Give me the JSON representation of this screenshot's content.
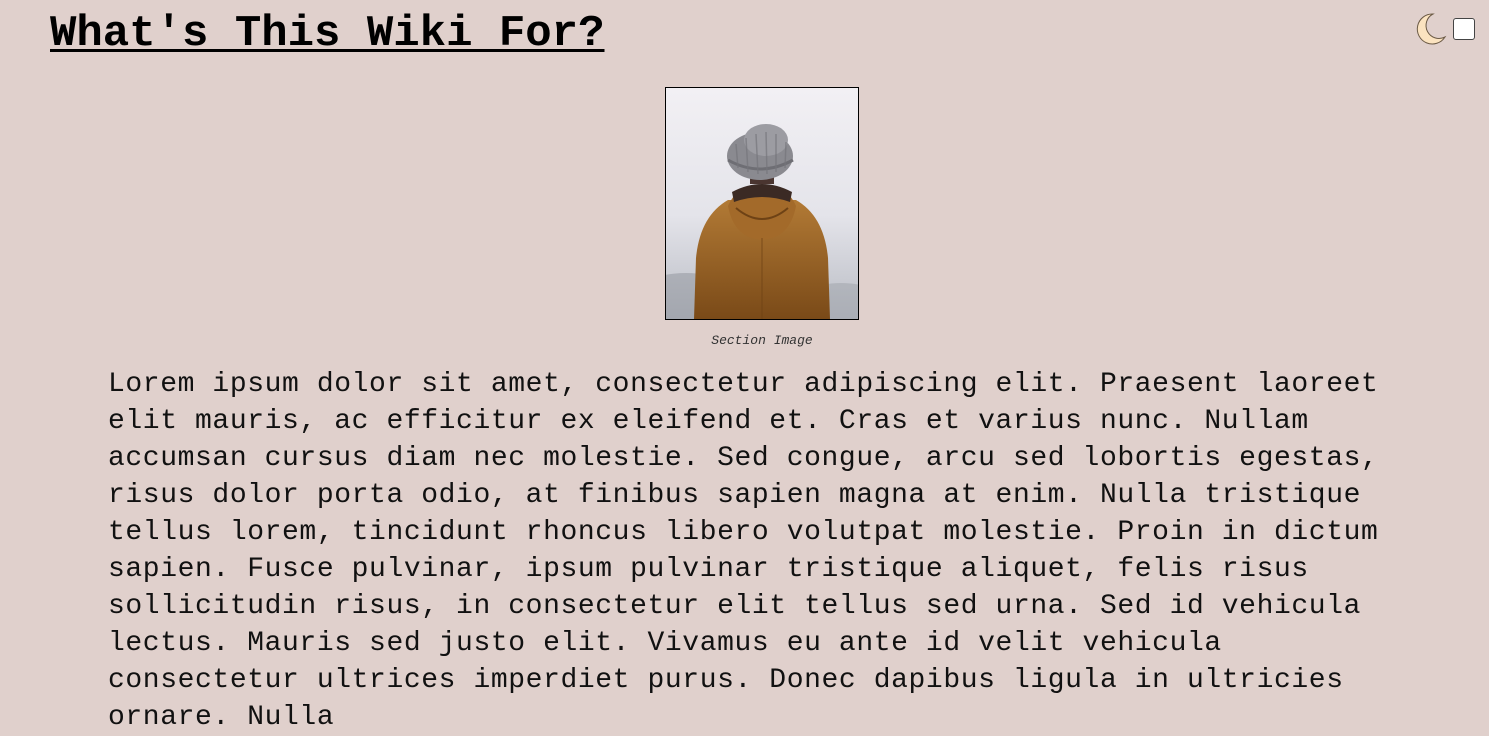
{
  "page": {
    "title": "What's This Wiki For?"
  },
  "controls": {
    "theme_icon": "moon-icon",
    "theme_toggle_checked": false
  },
  "section": {
    "image_caption": "Section Image",
    "image_subject": "person in knit beanie and orange hooded jacket seen from behind",
    "paragraph": "Lorem ipsum dolor sit amet, consectetur adipiscing elit. Praesent laoreet elit mauris, ac efficitur ex eleifend et. Cras et varius nunc. Nullam accumsan cursus diam nec molestie. Sed congue, arcu sed lobortis egestas, risus dolor porta odio, at finibus sapien magna at enim. Nulla tristique tellus lorem, tincidunt rhoncus libero volutpat molestie. Proin in dictum sapien. Fusce pulvinar, ipsum pulvinar tristique aliquet, felis risus sollicitudin risus, in consectetur elit tellus sed urna. Sed id vehicula lectus. Mauris sed justo elit. Vivamus eu ante id velit vehicula consectetur ultrices imperdiet purus. Donec dapibus ligula in ultricies ornare. Nulla"
  },
  "colors": {
    "background": "#e0d0cc",
    "text": "#111111",
    "moon_fill": "#fbe3c0"
  }
}
